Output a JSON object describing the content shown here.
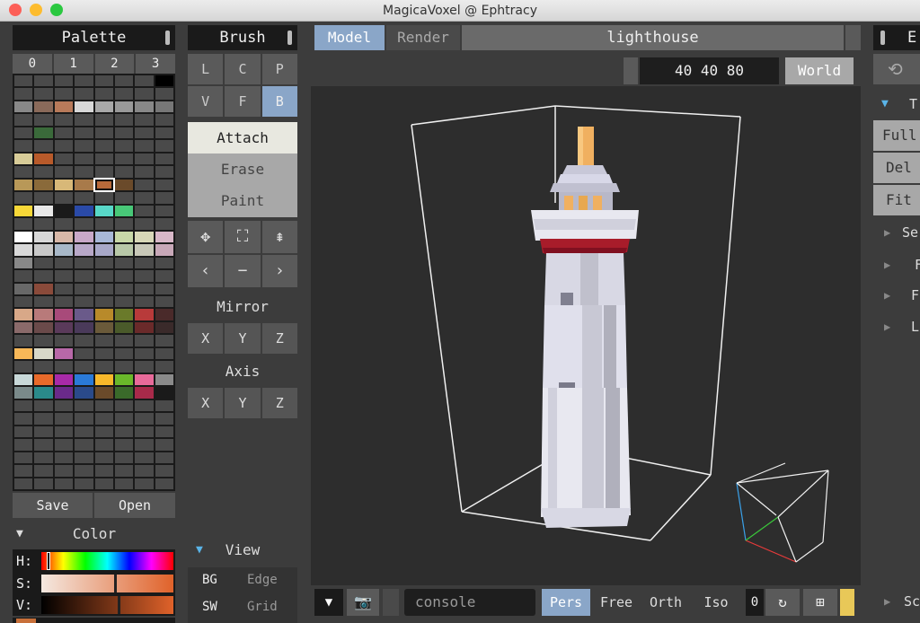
{
  "window": {
    "title": "MagicaVoxel @ Ephtracy"
  },
  "palette": {
    "title": "Palette",
    "tabs": [
      "0",
      "1",
      "2",
      "3"
    ],
    "save_label": "Save",
    "open_label": "Open",
    "colors": [
      "#4a4a4a",
      "#4a4a4a",
      "#4a4a4a",
      "#4a4a4a",
      "#4a4a4a",
      "#4a4a4a",
      "#4a4a4a",
      "#000000",
      "#4a4a4a",
      "#4a4a4a",
      "#4a4a4a",
      "#4a4a4a",
      "#4a4a4a",
      "#4a4a4a",
      "#4a4a4a",
      "#4a4a4a",
      "#888888",
      "#8a6a5a",
      "#b87a5a",
      "#d8d8d8",
      "#a8a8a8",
      "#999999",
      "#888888",
      "#777777",
      "#4a4a4a",
      "#4a4a4a",
      "#4a4a4a",
      "#4a4a4a",
      "#4a4a4a",
      "#4a4a4a",
      "#4a4a4a",
      "#4a4a4a",
      "#4a4a4a",
      "#3a6a3a",
      "#4a4a4a",
      "#4a4a4a",
      "#4a4a4a",
      "#4a4a4a",
      "#4a4a4a",
      "#4a4a4a",
      "#4a4a4a",
      "#4a4a4a",
      "#4a4a4a",
      "#4a4a4a",
      "#4a4a4a",
      "#4a4a4a",
      "#4a4a4a",
      "#4a4a4a",
      "#d8cc98",
      "#b85a2a",
      "#4a4a4a",
      "#4a4a4a",
      "#4a4a4a",
      "#4a4a4a",
      "#4a4a4a",
      "#4a4a4a",
      "#4a4a4a",
      "#4a4a4a",
      "#4a4a4a",
      "#4a4a4a",
      "#4a4a4a",
      "#4a4a4a",
      "#4a4a4a",
      "#4a4a4a",
      "#b89858",
      "#8a6a3a",
      "#d8b878",
      "#a87a4a",
      "#b86a3a",
      "#6a4a2a",
      "#4a4a4a",
      "#4a4a4a",
      "#4a4a4a",
      "#4a4a4a",
      "#4a4a4a",
      "#4a4a4a",
      "#4a4a4a",
      "#4a4a4a",
      "#4a4a4a",
      "#4a4a4a",
      "#f8d838",
      "#e8e8e8",
      "#1a1a1a",
      "#2a4aa8",
      "#58d8c8",
      "#48c878",
      "#4a4a4a",
      "#4a4a4a",
      "#4a4a4a",
      "#4a4a4a",
      "#4a4a4a",
      "#4a4a4a",
      "#4a4a4a",
      "#4a4a4a",
      "#4a4a4a",
      "#4a4a4a",
      "#ffffff",
      "#d8d8d8",
      "#d8b8a8",
      "#c8a8c8",
      "#a8b8d8",
      "#c8d8a8",
      "#d8d8b8",
      "#d8b8c8",
      "#d8d8d8",
      "#c8c8c8",
      "#a8b8c8",
      "#b8a8c8",
      "#a8a8c8",
      "#b8c8a8",
      "#c8c8b8",
      "#c8a8b8",
      "#888888",
      "#4a4a4a",
      "#4a4a4a",
      "#4a4a4a",
      "#4a4a4a",
      "#4a4a4a",
      "#4a4a4a",
      "#4a4a4a",
      "#4a4a4a",
      "#4a4a4a",
      "#4a4a4a",
      "#4a4a4a",
      "#4a4a4a",
      "#4a4a4a",
      "#4a4a4a",
      "#4a4a4a",
      "#686868",
      "#8a4a3a",
      "#4a4a4a",
      "#4a4a4a",
      "#4a4a4a",
      "#4a4a4a",
      "#4a4a4a",
      "#4a4a4a",
      "#4a4a4a",
      "#4a4a4a",
      "#4a4a4a",
      "#4a4a4a",
      "#4a4a4a",
      "#4a4a4a",
      "#4a4a4a",
      "#4a4a4a",
      "#d8a888",
      "#b87a7a",
      "#a84a7a",
      "#6a5a8a",
      "#b88a2a",
      "#6a7a2a",
      "#b83a3a",
      "#4a2a2a",
      "#8a6a6a",
      "#6a4a4a",
      "#5a3a5a",
      "#4a3a5a",
      "#6a5a3a",
      "#4a5a2a",
      "#6a2a2a",
      "#3a2a2a",
      "#4a4a4a",
      "#4a4a4a",
      "#4a4a4a",
      "#4a4a4a",
      "#4a4a4a",
      "#4a4a4a",
      "#4a4a4a",
      "#4a4a4a",
      "#f8b858",
      "#d8d8c8",
      "#b868a8",
      "#4a4a4a",
      "#4a4a4a",
      "#4a4a4a",
      "#4a4a4a",
      "#4a4a4a",
      "#4a4a4a",
      "#4a4a4a",
      "#4a4a4a",
      "#4a4a4a",
      "#4a4a4a",
      "#4a4a4a",
      "#4a4a4a",
      "#4a4a4a",
      "#c8d8d8",
      "#e86a2a",
      "#a82aa8",
      "#2a7ad8",
      "#f8b82a",
      "#6ab82a",
      "#e86a9a",
      "#8a8a8a",
      "#7a8a8a",
      "#2a8a8a",
      "#6a2a8a",
      "#2a4a8a",
      "#6a4a2a",
      "#3a6a2a",
      "#a82a4a",
      "#1a1a1a",
      "#4a4a4a",
      "#4a4a4a",
      "#4a4a4a",
      "#4a4a4a",
      "#4a4a4a",
      "#4a4a4a",
      "#4a4a4a",
      "#4a4a4a",
      "#4a4a4a",
      "#4a4a4a",
      "#4a4a4a",
      "#4a4a4a",
      "#4a4a4a",
      "#4a4a4a",
      "#4a4a4a",
      "#4a4a4a",
      "#4a4a4a",
      "#4a4a4a",
      "#4a4a4a",
      "#4a4a4a",
      "#4a4a4a",
      "#4a4a4a",
      "#4a4a4a",
      "#4a4a4a",
      "#4a4a4a",
      "#4a4a4a",
      "#4a4a4a",
      "#4a4a4a",
      "#4a4a4a",
      "#4a4a4a",
      "#4a4a4a",
      "#4a4a4a",
      "#4a4a4a",
      "#4a4a4a",
      "#4a4a4a",
      "#4a4a4a",
      "#4a4a4a",
      "#4a4a4a",
      "#4a4a4a",
      "#4a4a4a",
      "#4a4a4a",
      "#4a4a4a",
      "#4a4a4a",
      "#4a4a4a",
      "#4a4a4a",
      "#4a4a4a",
      "#4a4a4a",
      "#4a4a4a",
      "#4a4a4a",
      "#4a4a4a",
      "#4a4a4a",
      "#4a4a4a",
      "#4a4a4a",
      "#4a4a4a",
      "#4a4a4a",
      "#4a4a4a"
    ],
    "selected_index": 68
  },
  "color": {
    "title": "Color",
    "h_label": "H:",
    "s_label": "S:",
    "v_label": "V:",
    "h_level": 0.04,
    "s_level": 0.55,
    "v_level": 0.58,
    "accent": "#c8703a"
  },
  "brush": {
    "title": "Brush",
    "types": [
      "L",
      "C",
      "P",
      "V",
      "F",
      "B"
    ],
    "active_type": "B",
    "modes": [
      "Attach",
      "Erase",
      "Paint"
    ],
    "active_mode": "Attach",
    "mirror_title": "Mirror",
    "axis_title": "Axis",
    "axes": [
      "X",
      "Y",
      "Z"
    ]
  },
  "view": {
    "title": "View",
    "bg_label": "BG",
    "edge_label": "Edge",
    "sw_label": "SW",
    "grid_label": "Grid"
  },
  "top": {
    "model_tab": "Model",
    "render_tab": "Render",
    "filename": "lighthouse",
    "dims": "40 40 80",
    "world_label": "World"
  },
  "bottom": {
    "console_placeholder": "console",
    "pers": "Pers",
    "free": "Free",
    "orth": "Orth",
    "iso": "Iso",
    "zero": "0"
  },
  "edit": {
    "title_prefix": "E",
    "tree_label": "T",
    "buttons": [
      "Full",
      "Del",
      "Fit"
    ],
    "sections": [
      "Se",
      "F",
      "F",
      "L",
      "Sc"
    ]
  },
  "colors": {
    "accent_blue": "#8aa6c8",
    "yellow_tab": "#e8c858"
  }
}
